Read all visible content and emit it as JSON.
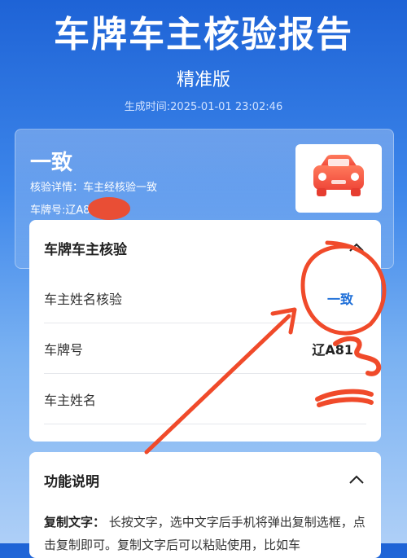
{
  "header": {
    "title": "车牌车主核验报告",
    "version": "精准版",
    "generated_label": "生成时间:",
    "generated_time": "2025-01-01 23:02:46"
  },
  "summary": {
    "status": "一致",
    "detail_label": "核验详情：",
    "detail_value": "车主经核验一致",
    "plate_label": "车牌号:",
    "plate_value": "辽A8"
  },
  "verification_card": {
    "title": "车牌车主核验",
    "rows": [
      {
        "label": "车主姓名核验",
        "value": "一致"
      },
      {
        "label": "车牌号",
        "value": "辽A81"
      },
      {
        "label": "车主姓名",
        "value": ""
      }
    ]
  },
  "function_card": {
    "title": "功能说明",
    "desc_label": "复制文字：",
    "desc_text": "长按文字，选中文字后手机将弹出复制选框，点击复制即可。复制文字后可以粘贴使用，比如车"
  },
  "icons": {
    "car": "car-icon",
    "chevron": "chevron-up-icon"
  },
  "colors": {
    "accent": "#1f6fd8",
    "car": "#f25a4a",
    "scribble": "#f04a2a"
  }
}
